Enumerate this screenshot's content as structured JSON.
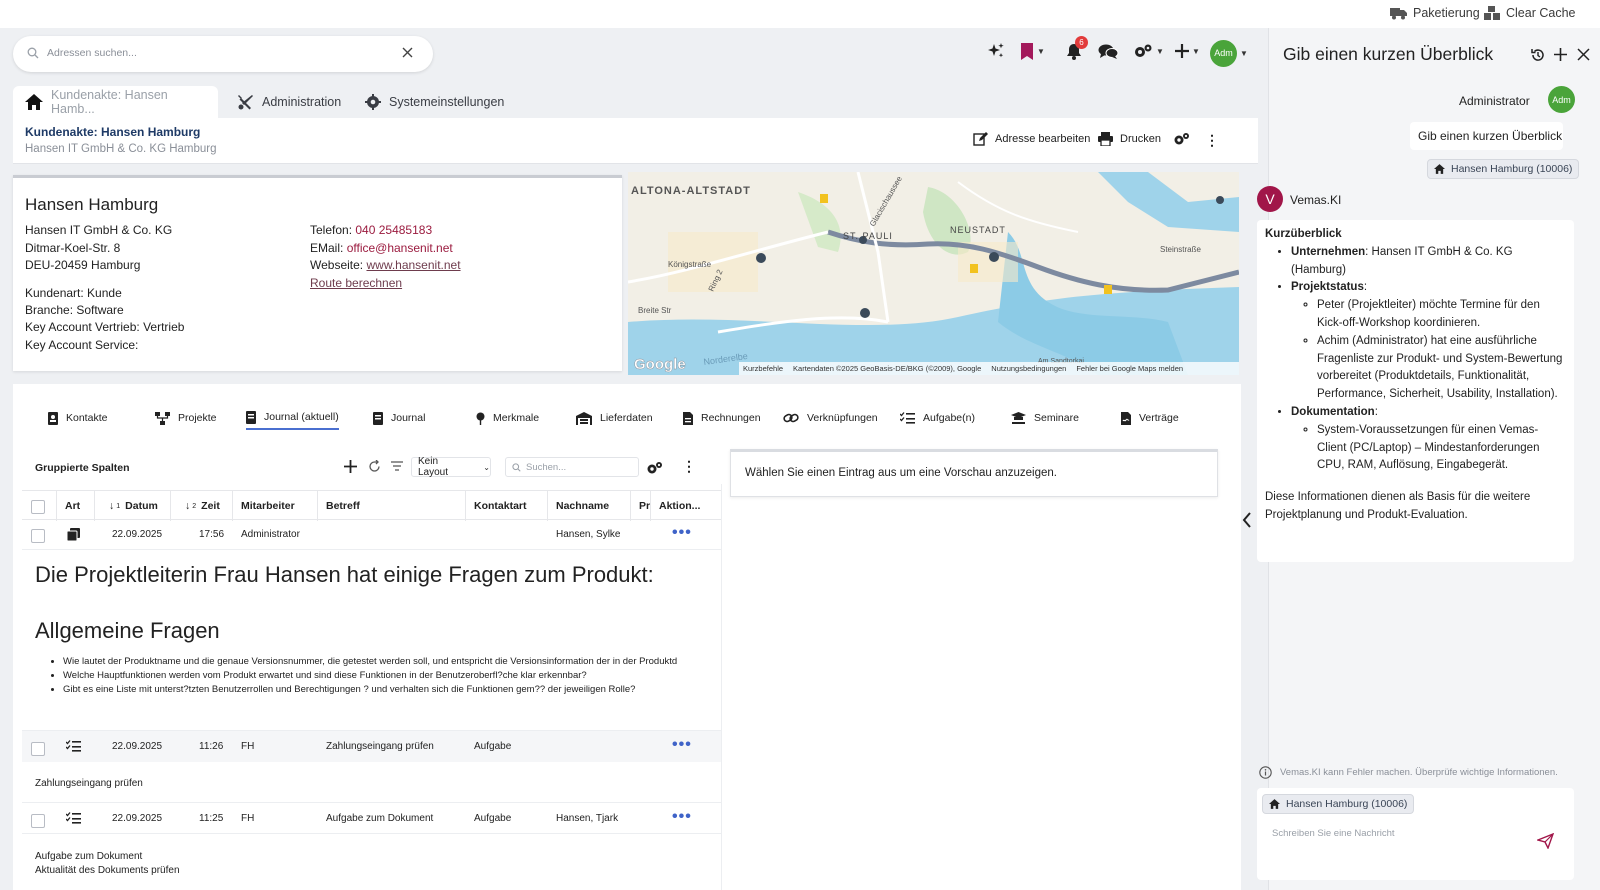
{
  "system_bar": {
    "packaging_label": "Paketierung",
    "clear_cache_label": "Clear Cache"
  },
  "search": {
    "placeholder": "Adressen suchen..."
  },
  "top_icons": {
    "notification_count": "6",
    "avatar_initials": "Adm"
  },
  "tabs": [
    {
      "label": "Kundenakte: Hansen Hamb..."
    },
    {
      "label": "Administration"
    },
    {
      "label": "Systemeinstellungen"
    }
  ],
  "record": {
    "title": "Kundenakte: Hansen Hamburg",
    "subtitle": "Hansen IT GmbH & Co. KG Hamburg",
    "edit_label": "Adresse bearbeiten",
    "print_label": "Drucken"
  },
  "address": {
    "name": "Hansen Hamburg",
    "company": "Hansen IT GmbH & Co. KG",
    "street": "Ditmar-Koel-Str. 8",
    "city": "DEU-20459 Hamburg",
    "customer_type": "Kundenart: Kunde",
    "industry": "Branche: Software",
    "key_account_sales": "Key Account Vertrieb: Vertrieb",
    "key_account_service": "Key Account Service:",
    "phone_label": "Telefon:",
    "phone": "040 25485183",
    "email_label": "EMail:",
    "email": "office@hansenit.net",
    "website_label": "Webseite:",
    "website": "www.hansenit.net",
    "route_label": "Route berechnen"
  },
  "map": {
    "districts": [
      "ALTONA-ALTSTADT",
      "NEUSTADT",
      "ST. PAULI"
    ],
    "streets": [
      "Königstraße",
      "Breite Str",
      "Ring 2",
      "Steinstraße",
      "Glacischaussee",
      "Norderelbe",
      "Am Sandtorkai"
    ],
    "google_logo": "Google",
    "attribution": [
      "Kurzbefehle",
      "Kartendaten ©2025 GeoBasis-DE/BKG (©2009), Google",
      "Nutzungsbedingungen",
      "Fehler bei Google Maps melden"
    ]
  },
  "subtabs": [
    {
      "label": "Kontakte"
    },
    {
      "label": "Projekte"
    },
    {
      "label": "Journal (aktuell)"
    },
    {
      "label": "Journal"
    },
    {
      "label": "Merkmale"
    },
    {
      "label": "Lieferdaten"
    },
    {
      "label": "Rechnungen"
    },
    {
      "label": "Verknüpfungen"
    },
    {
      "label": "Aufgabe(n)"
    },
    {
      "label": "Seminare"
    },
    {
      "label": "Verträge"
    }
  ],
  "grid": {
    "group_label": "Gruppierte Spalten",
    "layout_select": "Kein Layout",
    "search_placeholder": "Suchen...",
    "columns": [
      "Art",
      "Datum",
      "Zeit",
      "Mitarbeiter",
      "Betreff",
      "Kontaktart",
      "Nachname",
      "Pr",
      "Aktion..."
    ],
    "sort_datum": "1",
    "sort_zeit": "2",
    "rows": [
      {
        "datum": "22.09.2025",
        "zeit": "17:56",
        "mitarbeiter": "Administrator",
        "betreff": "",
        "kontaktart": "",
        "nachname": "Hansen, Sylke"
      },
      {
        "datum": "22.09.2025",
        "zeit": "11:26",
        "mitarbeiter": "FH",
        "betreff": "Zahlungseingang prüfen",
        "kontaktart": "Aufgabe",
        "nachname": ""
      },
      {
        "datum": "22.09.2025",
        "zeit": "11:25",
        "mitarbeiter": "FH",
        "betreff": "Aufgabe zum Dokument",
        "kontaktart": "Aufgabe",
        "nachname": "Hansen, Tjark"
      }
    ],
    "detail1": {
      "heading1": "Die Projektleiterin Frau Hansen hat einige Fragen zum Produkt:",
      "heading2": "Allgemeine Fragen",
      "bullets": [
        "Wie lautet der Produktname und die genaue Versionsnummer, die getestet werden soll, und entspricht die Versionsinformation der in der Produktd",
        "Welche Hauptfunktionen werden vom Produkt erwartet und sind diese Funktionen in der Benutzeroberfl?che klar erkennbar?",
        "Gibt es eine Liste mit unterst?tzten Benutzerrollen und Berechtigungen ? und verhalten sich die Funktionen gem?? der jeweiligen Rolle?"
      ]
    },
    "detail2": "Zahlungseingang prüfen",
    "detail3_line1": "Aufgabe zum Dokument",
    "detail3_line2": "Aktualität des Dokuments prüfen"
  },
  "preview": {
    "text": "Wählen Sie einen Eintrag aus um eine Vorschau anzuzeigen."
  },
  "ai": {
    "title": "Gib einen kurzen Überblick",
    "user_name": "Administrator",
    "user_initials": "Adm",
    "user_message": "Gib einen kurzen Überblick",
    "context_chip": "Hansen Hamburg (10006)",
    "assistant_initial": "V",
    "assistant_name": "Vemas.KI",
    "answer": {
      "heading": "Kurzüberblick",
      "company_label": "Unternehmen",
      "company_text": ": Hansen IT GmbH & Co. KG (Hamburg)",
      "status_label": "Projektstatus",
      "status_colon": ":",
      "status_items": [
        "Peter (Projektleiter) möchte Termine für den Kick-off-Workshop koordinieren.",
        "Achim (Administrator) hat eine ausführliche Fragenliste zur Produkt- und System-Bewertung vorbereitet (Produktdetails, Funktionalität, Performance, Sicherheit, Usability, Installation)."
      ],
      "doc_label": "Dokumentation",
      "doc_colon": ":",
      "doc_items": [
        "System-Voraussetzungen für einen Vemas-Client (PC/Laptop) – Mindestanforderungen CPU, RAM, Auflösung, Eingabegerät."
      ],
      "footer": "Diese Informationen dienen als Basis für die weitere Projektplanung und Produkt-Evaluation."
    },
    "disclaimer": "Vemas.KI kann Fehler machen. Überprüfe wichtige Informationen.",
    "input_chip": "Hansen Hamburg (10006)",
    "input_placeholder": "Schreiben Sie eine Nachricht"
  }
}
